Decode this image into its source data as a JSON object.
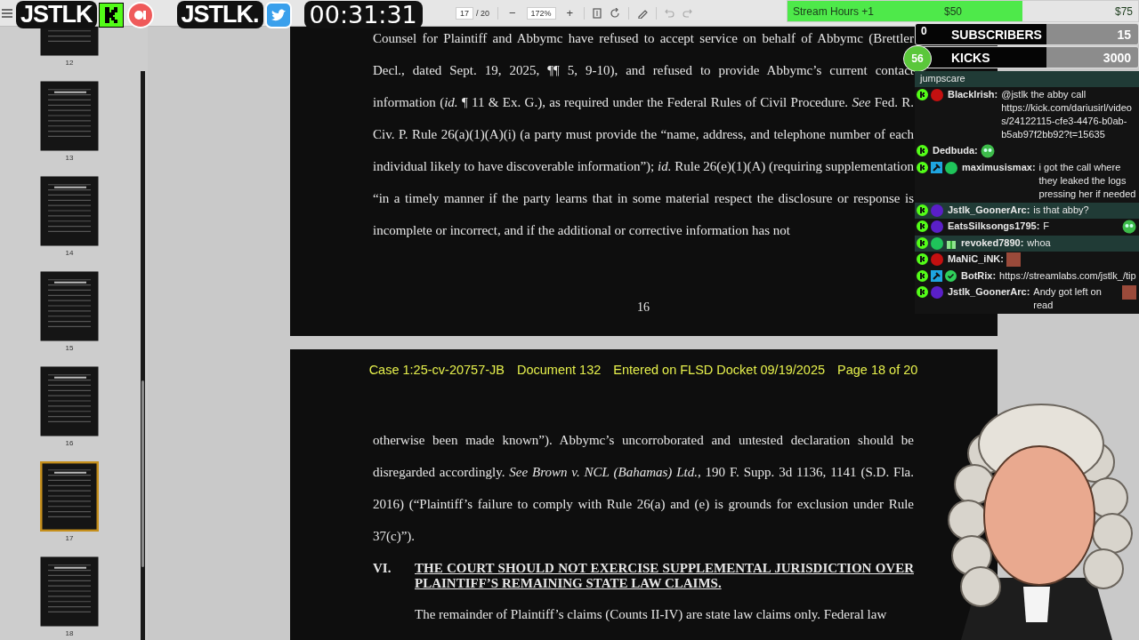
{
  "stream_overlay": {
    "logos": [
      {
        "kind": "kick",
        "text": "JSTLK"
      },
      {
        "kind": "twitter",
        "text": "JSTLK."
      }
    ],
    "timer": "00:31:31"
  },
  "toolbar": {
    "page_field": "17",
    "page_total": "/ 20",
    "zoom_out": "−",
    "zoom": "172%",
    "zoom_in": "+"
  },
  "goals": [
    {
      "kind": "progress",
      "label": "Stream Hours +1",
      "current": "$50",
      "target": "$75",
      "level": 0.67
    },
    {
      "kind": "counter",
      "current": "0",
      "label": "SUBSCRIBERS",
      "target": "15"
    },
    {
      "kind": "badge_counter",
      "current": "56",
      "label": "KICKS",
      "target": "3000"
    }
  ],
  "chat": [
    {
      "text": "jumpscare",
      "highlighted": true
    },
    {
      "badges": [
        {
          "kind": "kick"
        },
        {
          "kind": "sub",
          "color": "#c41010"
        }
      ],
      "user": "BlackIrish:",
      "text": "@jstlk the abby call https://kick.com/dariusirl/videos/24122115-cfe3-4476-b0ab-b5ab97f2bb92?t=15635",
      "highlighted": false
    },
    {
      "badges": [
        {
          "kind": "kick"
        }
      ],
      "user": "Dedbuda:",
      "emote": {
        "kind": "cartoon"
      },
      "highlighted": false
    },
    {
      "badges": [
        {
          "kind": "kick"
        },
        {
          "kind": "moderator"
        },
        {
          "kind": "sub",
          "color": "#1fc45a"
        }
      ],
      "user": "maximusismax:",
      "text": "i got the call where they leaked the logs pressing her if needed",
      "highlighted": false
    },
    {
      "badges": [
        {
          "kind": "kick"
        },
        {
          "kind": "sub",
          "color": "#5a1fc8"
        }
      ],
      "user": "Jstlk_GoonerArc:",
      "text": "is that abby?",
      "highlighted": true
    },
    {
      "badges": [
        {
          "kind": "kick"
        },
        {
          "kind": "sub",
          "color": "#5a1fc8"
        }
      ],
      "user": "EatsSilksongs1795:",
      "text": "F",
      "emote": {
        "kind": "cartoon"
      },
      "highlighted": false
    },
    {
      "badges": [
        {
          "kind": "kick"
        },
        {
          "kind": "sub",
          "color": "#1fc45a"
        },
        {
          "kind": "gift"
        }
      ],
      "user": "revoked7890:",
      "text": "whoa",
      "highlighted": true
    },
    {
      "badges": [
        {
          "kind": "kick"
        },
        {
          "kind": "sub",
          "color": "#c41010"
        }
      ],
      "user": "MaNiC_iNK:",
      "emote": {
        "kind": "photo"
      },
      "highlighted": false
    },
    {
      "badges": [
        {
          "kind": "kick"
        },
        {
          "kind": "moderator"
        },
        {
          "kind": "verified"
        }
      ],
      "user": "BotRix:",
      "text": "https://streamlabs.com/jstlk_/tip",
      "highlighted": false
    },
    {
      "badges": [
        {
          "kind": "kick"
        },
        {
          "kind": "sub",
          "color": "#5a1fc8"
        }
      ],
      "user": "Jstlk_GoonerArc:",
      "text": "Andy got left on read",
      "emote": {
        "kind": "photo"
      },
      "highlighted": false
    }
  ],
  "thumbnails": [
    {
      "label": "12",
      "selected": false
    },
    {
      "label": "13",
      "selected": false
    },
    {
      "label": "14",
      "selected": false
    },
    {
      "label": "15",
      "selected": false
    },
    {
      "label": "16",
      "selected": false
    },
    {
      "label": "17",
      "selected": true
    },
    {
      "label": "18",
      "selected": false
    }
  ],
  "document": {
    "page_top": {
      "paragraph": "Counsel for Plaintiff and Abbymc have refused to accept service on behalf of Abbymc (Brettler Decl., dated Sept. 19, 2025, ¶¶ 5, 9-10), and refused to provide Abbymc’s current contact information (*id.* ¶ 11 & Ex. G.), as required under the Federal Rules of Civil Procedure. *See* Fed. R. Civ. P. Rule 26(a)(1)(A)(i) (a party must provide the “name, address, and telephone number of each individual likely to have discoverable information”); *id.* Rule 26(e)(1)(A) (requiring supplementation “in a timely manner if the party learns that in some material respect the disclosure or response is incomplete or incorrect, and if the additional or corrective information has not",
      "page_number": "16"
    },
    "page_bottom": {
      "header": [
        "Case 1:25-cv-20757-JB",
        "Document 132",
        "Entered on FLSD Docket 09/19/2025",
        "Page 18 of 20"
      ],
      "paragraph": "otherwise been made known”). Abbymc’s uncorroborated and untested declaration should be disregarded accordingly. *See Brown v. NCL (Bahamas) Ltd.*, 190 F. Supp. 3d 1136, 1141 (S.D. Fla. 2016) (“Plaintiff’s failure to comply with Rule 26(a) and (e) is grounds for exclusion under Rule 37(c)”).",
      "heading": {
        "number": "VI.",
        "title": "THE COURT SHOULD NOT EXERCISE SUPPLEMENTAL JURISDICTION OVER PLAINTIFF’S REMAINING STATE LAW CLAIMS."
      },
      "paragraph_2": "The remainder of Plaintiff’s claims (Counts II-IV) are state law claims only. Federal law"
    }
  }
}
